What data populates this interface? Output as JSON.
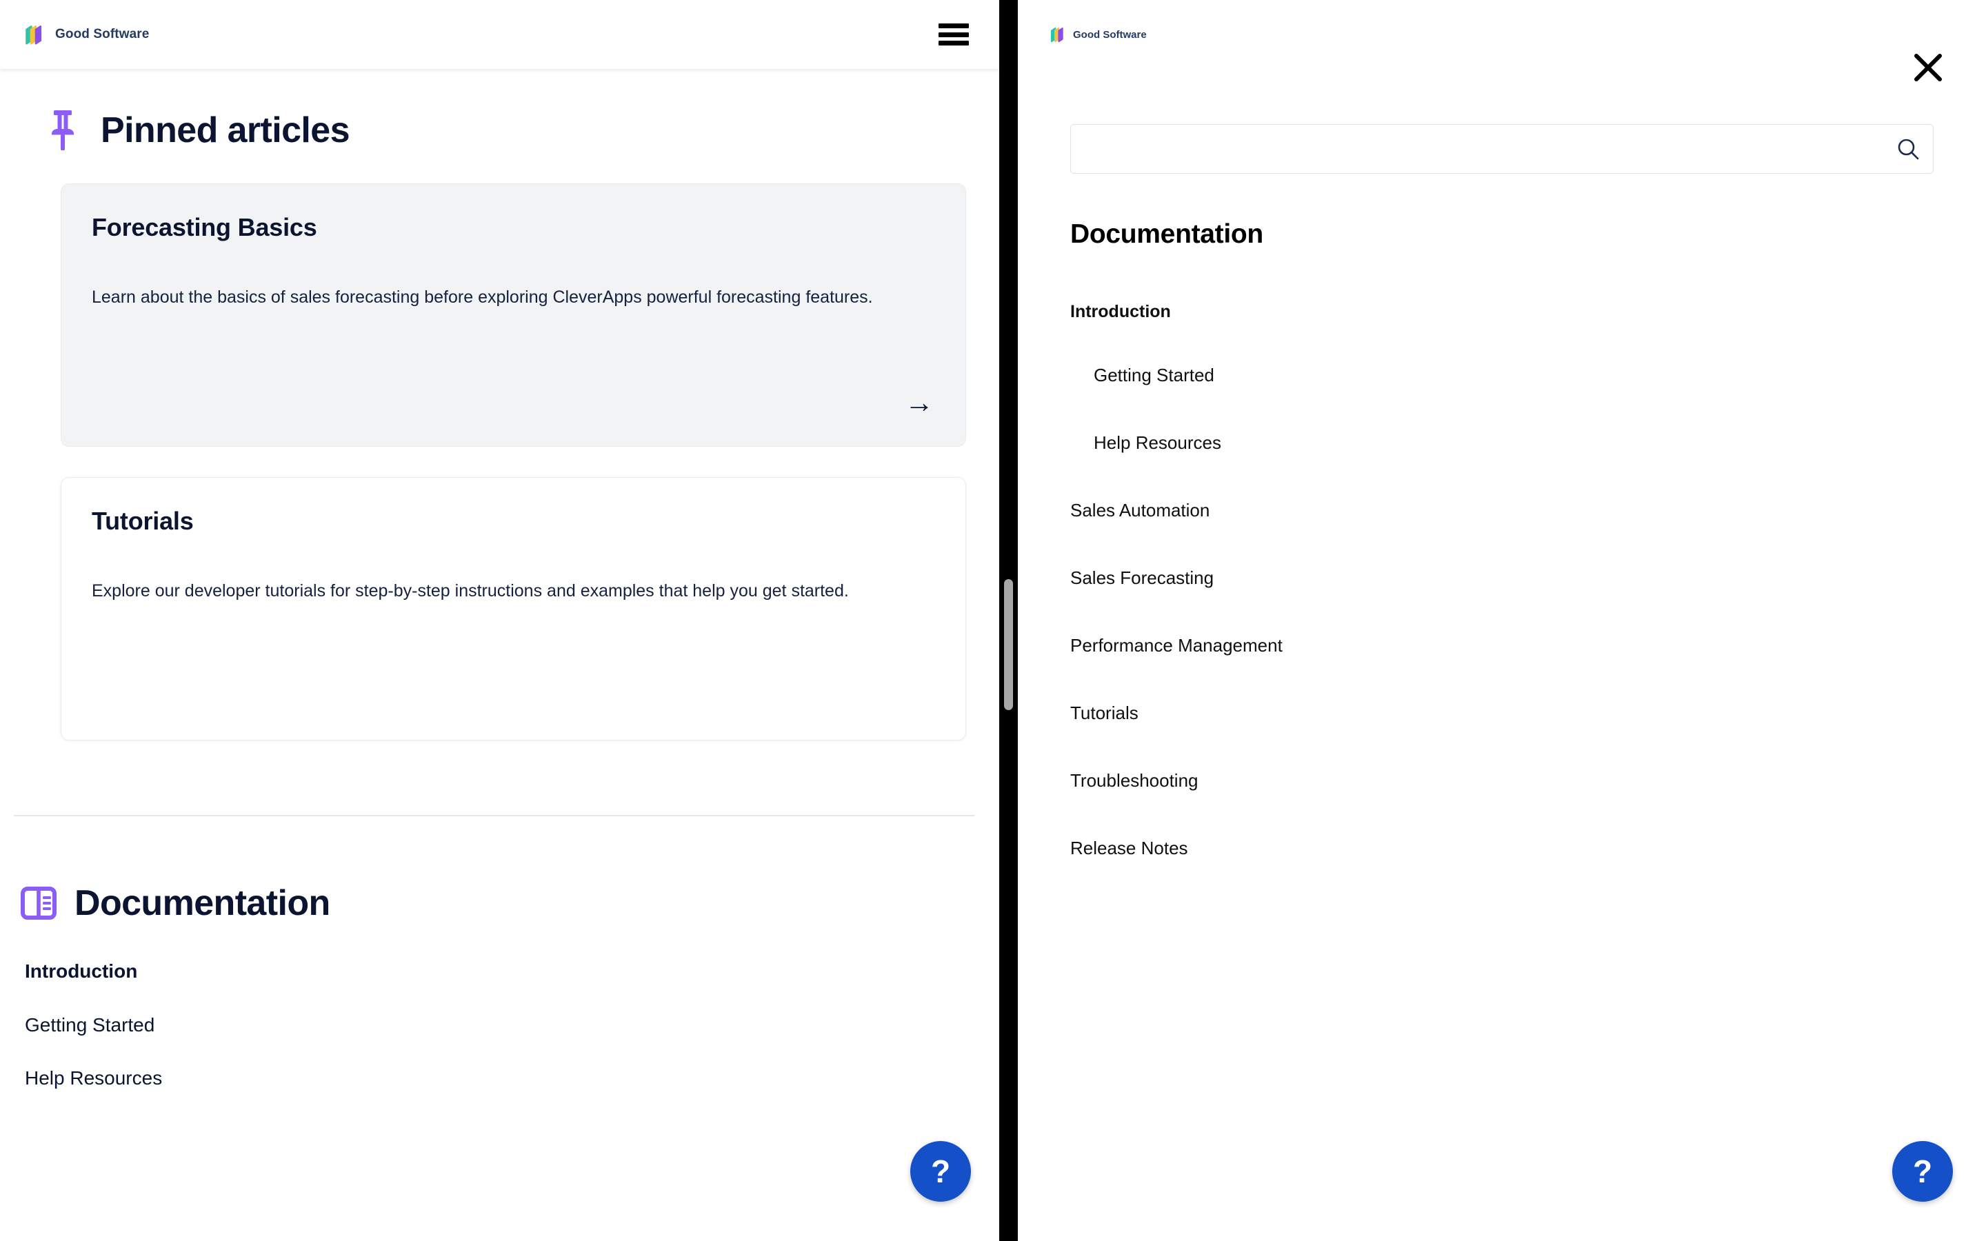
{
  "brand": {
    "name": "Good Software",
    "logo_icon": "stacked-cubes-logo",
    "colors": {
      "teal": "#2EC4A6",
      "yellow": "#F5C23E",
      "purple": "#8A4FE8",
      "wordmark": "#243B63"
    }
  },
  "left_panel": {
    "header": {
      "menu_icon": "hamburger-menu-icon"
    },
    "pinned": {
      "icon": "pushpin-icon",
      "icon_color": "#8B5CF6",
      "title": "Pinned articles",
      "cards": [
        {
          "title": "Forecasting Basics",
          "description": "Learn about the basics of sales forecasting before exploring CleverApps powerful forecasting features.",
          "arrow": "→",
          "has_arrow": true,
          "style": "shaded"
        },
        {
          "title": "Tutorials",
          "description": "Explore our developer tutorials for step-by-step instructions and examples that help you get started.",
          "arrow": "",
          "has_arrow": false,
          "style": "plain"
        }
      ]
    },
    "documentation": {
      "icon": "book-layout-icon",
      "icon_color": "#8B5CF6",
      "title": "Documentation",
      "nav": [
        {
          "label": "Introduction",
          "bold": true
        },
        {
          "label": "Getting Started",
          "bold": false
        },
        {
          "label": "Help Resources",
          "bold": false
        }
      ]
    },
    "help_button": {
      "label": "?",
      "color": "#1450C8",
      "icon": "question-mark-icon"
    }
  },
  "right_panel": {
    "close_icon": "close-x-icon",
    "search": {
      "value": "",
      "placeholder": "",
      "icon": "search-icon"
    },
    "title": "Documentation",
    "nav": [
      {
        "label": "Introduction",
        "bold": true,
        "sub": false
      },
      {
        "label": "Getting Started",
        "bold": false,
        "sub": true
      },
      {
        "label": "Help Resources",
        "bold": false,
        "sub": true
      },
      {
        "label": "Sales Automation",
        "bold": false,
        "sub": false
      },
      {
        "label": "Sales Forecasting",
        "bold": false,
        "sub": false
      },
      {
        "label": "Performance Management",
        "bold": false,
        "sub": false
      },
      {
        "label": "Tutorials",
        "bold": false,
        "sub": false
      },
      {
        "label": "Troubleshooting",
        "bold": false,
        "sub": false
      },
      {
        "label": "Release Notes",
        "bold": false,
        "sub": false
      }
    ],
    "help_button": {
      "label": "?",
      "color": "#1450C8",
      "icon": "question-mark-icon"
    }
  },
  "separator": {
    "color": "#000000",
    "scrollbar_color": "#A8A8A8"
  }
}
